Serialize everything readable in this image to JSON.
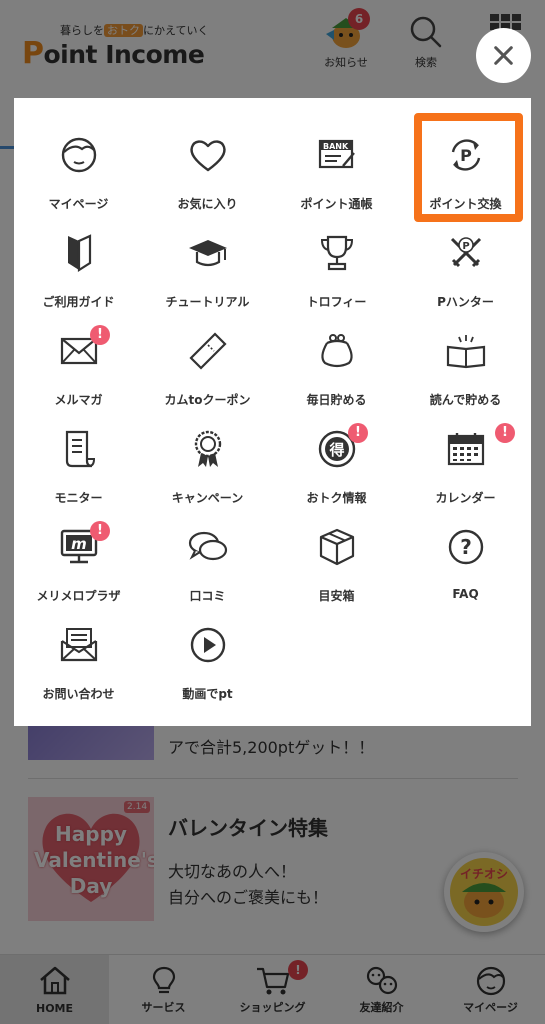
{
  "header": {
    "logo_tagline_pre": "暮らしを",
    "logo_tagline_highlight": "おトク",
    "logo_tagline_post": "にかえていく",
    "logo_p": "P",
    "logo_rest": "oint Income",
    "notice_label": "お知らせ",
    "notice_count": "6",
    "search_label": "検索"
  },
  "background": {
    "article1_text": "アで合計5,200ptゲット！！",
    "article2_title": "バレンタイン特集",
    "article2_desc1": "大切なあの人へ！",
    "article2_desc2": "自分へのご褒美にも！",
    "article2_thumb_text": "Happy Valentine's Day",
    "article2_thumb_date": "2.14",
    "pick_badge_text": "イチオシ"
  },
  "bottom_nav": {
    "items": [
      {
        "label": "HOME",
        "icon": "home-icon",
        "active": true
      },
      {
        "label": "サービス",
        "icon": "lightbulb-icon"
      },
      {
        "label": "ショッピング",
        "icon": "cart-icon",
        "badge": "!"
      },
      {
        "label": "友達紹介",
        "icon": "friends-icon"
      },
      {
        "label": "マイページ",
        "icon": "mypage-face-icon"
      }
    ]
  },
  "menu": {
    "selected_item": "ポイント交換",
    "alert_mark": "!",
    "items": [
      {
        "label": "マイページ",
        "icon": "face-icon"
      },
      {
        "label": "お気に入り",
        "icon": "heart-icon"
      },
      {
        "label": "ポイント通帳",
        "icon": "bankbook-icon",
        "icon_text": "BANK"
      },
      {
        "label": "ポイント交換",
        "icon": "point-exchange-icon",
        "icon_text": "P"
      },
      {
        "label": "ご利用ガイド",
        "icon": "beginner-mark-icon"
      },
      {
        "label": "チュートリアル",
        "icon": "graduation-cap-icon"
      },
      {
        "label": "トロフィー",
        "icon": "trophy-icon"
      },
      {
        "label": "Pハンター",
        "icon": "crossed-swords-icon",
        "icon_text": "P"
      },
      {
        "label": "メルマガ",
        "icon": "mail-icon"
      },
      {
        "label": "カムtoクーポン",
        "icon": "coupon-ticket-icon"
      },
      {
        "label": "毎日貯める",
        "icon": "coin-purse-icon"
      },
      {
        "label": "読んで貯める",
        "icon": "open-book-icon"
      },
      {
        "label": "モニター",
        "icon": "document-icon"
      },
      {
        "label": "キャンペーン",
        "icon": "rosette-icon"
      },
      {
        "label": "おトク情報",
        "icon": "deal-info-icon",
        "icon_text": "得"
      },
      {
        "label": "カレンダー",
        "icon": "calendar-icon"
      },
      {
        "label": "メリメロプラザ",
        "icon": "monitor-m-icon",
        "icon_text": "m"
      },
      {
        "label": "口コミ",
        "icon": "chat-bubbles-icon"
      },
      {
        "label": "目安箱",
        "icon": "box-icon"
      },
      {
        "label": "FAQ",
        "icon": "question-icon",
        "icon_text": "?"
      },
      {
        "label": "お問い合わせ",
        "icon": "inquiry-mail-icon"
      },
      {
        "label": "動画でpt",
        "icon": "play-icon"
      }
    ]
  }
}
